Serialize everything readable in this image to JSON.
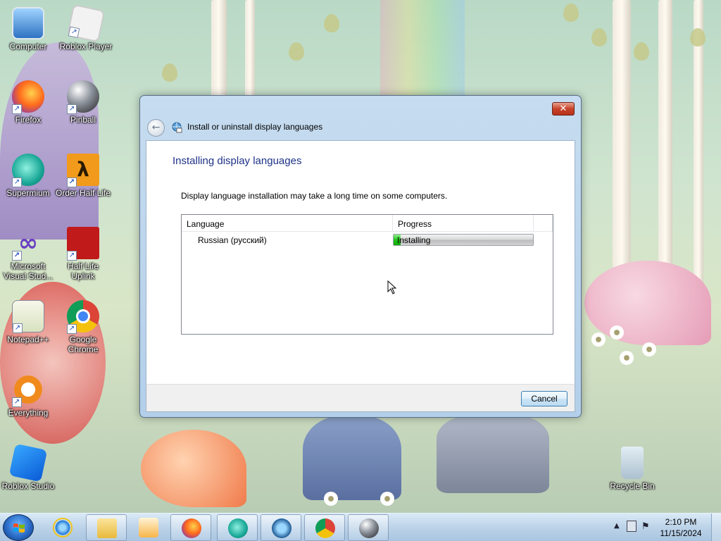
{
  "desktop": {
    "icons": [
      {
        "label": "Computer",
        "icon": "computer-icon"
      },
      {
        "label": "Roblox Player",
        "icon": "roblox-player-icon"
      },
      {
        "label": "Firefox",
        "icon": "firefox-icon"
      },
      {
        "label": "Pinball",
        "icon": "pinball-icon"
      },
      {
        "label": "Supermium",
        "icon": "supermium-icon"
      },
      {
        "label": "Order Half Life",
        "icon": "half-life-icon"
      },
      {
        "label": "Microsoft Visual Stud...",
        "icon": "visual-studio-icon"
      },
      {
        "label": "Half Life Uplink",
        "icon": "half-life-uplink-icon"
      },
      {
        "label": "Notepad++",
        "icon": "notepadpp-icon"
      },
      {
        "label": "Google Chrome",
        "icon": "chrome-icon"
      },
      {
        "label": "Everything",
        "icon": "everything-icon"
      },
      {
        "label": "Roblox Studio",
        "icon": "roblox-studio-icon"
      },
      {
        "label": "Recycle Bin",
        "icon": "recycle-bin-icon"
      }
    ]
  },
  "dialog": {
    "window_title": "Install or uninstall display languages",
    "close_label": "✕",
    "heading": "Installing display languages",
    "info": "Display language installation may take a long time on some computers.",
    "columns": {
      "language": "Language",
      "progress": "Progress"
    },
    "rows": [
      {
        "language": "Russian (русский)",
        "status": "Installing",
        "progress": 0.05
      }
    ],
    "cancel_label": "Cancel"
  },
  "taskbar": {
    "pinned": [
      "start-icon",
      "internet-explorer-icon",
      "file-explorer-icon",
      "media-player-icon",
      "firefox-icon",
      "supermium-icon",
      "language-installer-icon",
      "chrome-icon",
      "pinball-icon"
    ],
    "time": "2:10 PM",
    "date": "11/15/2024"
  },
  "colors": {
    "dialog_heading": "#1e3287",
    "progress_green": "#22c21a",
    "close_red": "#c7442a"
  }
}
